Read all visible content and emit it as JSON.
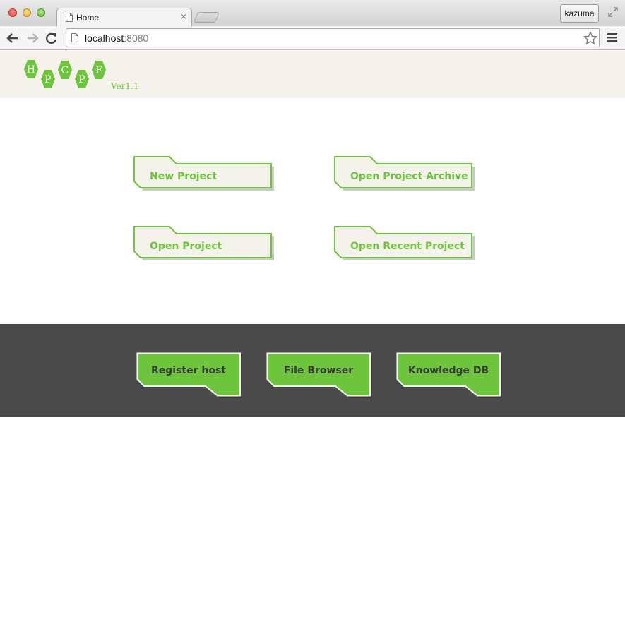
{
  "browser": {
    "tab_title": "Home",
    "tab_close": "×",
    "url_host": "localhost",
    "url_port": ":8080",
    "user_name": "kazuma"
  },
  "header": {
    "logo_letters": [
      "H",
      "P",
      "C",
      "P",
      "F"
    ],
    "version": "Ver1.1"
  },
  "projects": {
    "new_project": "New Project",
    "open_project_archive": "Open Project Archive",
    "open_project": "Open Project",
    "open_recent_project": "Open Recent Project"
  },
  "tools": {
    "register_host": "Register host",
    "file_browser": "File Browser",
    "knowledge_db": "Knowledge DB"
  },
  "colors": {
    "brand_green": "#6cc53a",
    "header_bg": "#f4f2ea",
    "footer_bg": "#4a4a4a"
  }
}
